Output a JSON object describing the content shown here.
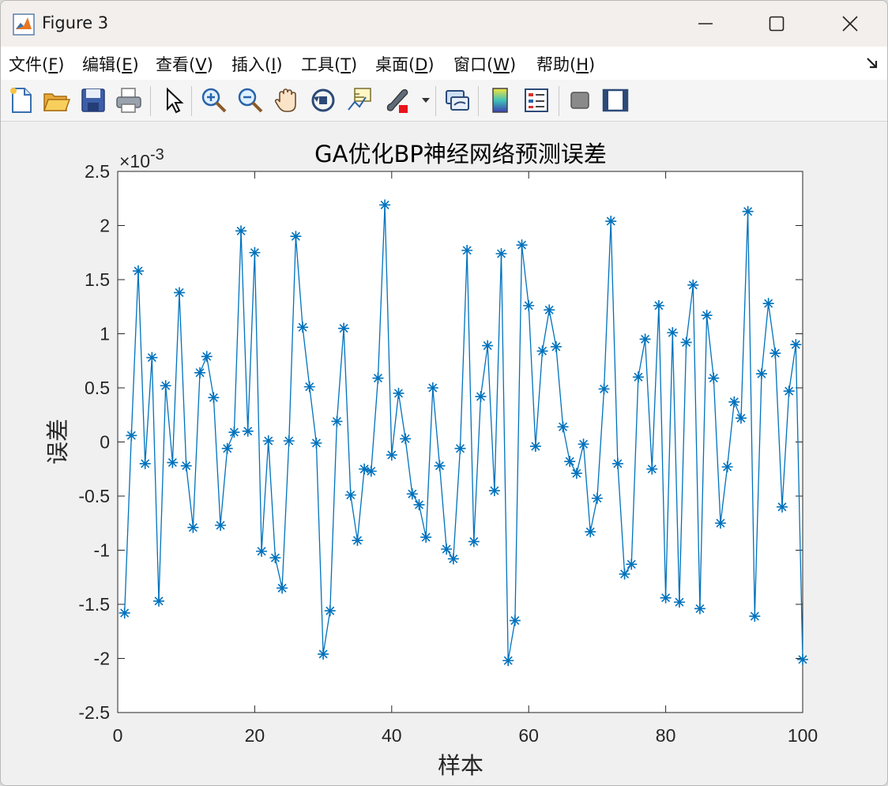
{
  "window": {
    "title": "Figure 3"
  },
  "menu": [
    {
      "text": "文件(",
      "key": "F",
      "end": ")"
    },
    {
      "text": "编辑(",
      "key": "E",
      "end": ")"
    },
    {
      "text": "查看(",
      "key": "V",
      "end": ")"
    },
    {
      "text": "插入(",
      "key": "I",
      "end": ")"
    },
    {
      "text": "工具(",
      "key": "T",
      "end": ")"
    },
    {
      "text": "桌面(",
      "key": "D",
      "end": ")"
    },
    {
      "text": "窗口(",
      "key": "W",
      "end": ")"
    },
    {
      "text": "帮助(",
      "key": "H",
      "end": ")"
    }
  ],
  "toolbar": {
    "icons": [
      "new-figure-icon",
      "open-file-icon",
      "save-icon",
      "print-icon",
      "select-arrow-icon",
      "zoom-in-icon",
      "zoom-out-icon",
      "pan-hand-icon",
      "rotate-3d-icon",
      "data-cursor-icon",
      "brush-icon",
      "link-plot-icon",
      "colorbar-icon",
      "legend-icon",
      "hide-plot-tools-icon",
      "show-plot-tools-icon"
    ]
  },
  "colors": {
    "series": "#0072BD",
    "titlebar": "#f3efec",
    "plot_bg": "#ffffff",
    "figure_bg": "#f0f0f0"
  },
  "chart_data": {
    "type": "line",
    "title": "GA优化BP神经网络预测误差",
    "xlabel": "样本",
    "ylabel": "误差",
    "exponent_label": "×10",
    "exponent_power": "-3",
    "xlim": [
      0,
      100
    ],
    "ylim": [
      -2.5,
      2.5
    ],
    "xticks": [
      "0",
      "20",
      "40",
      "60",
      "80",
      "100"
    ],
    "yticks": [
      "-2.5",
      "-2",
      "-1.5",
      "-1",
      "-0.5",
      "0",
      "0.5",
      "1",
      "1.5",
      "2",
      "2.5"
    ],
    "marker": "asterisk",
    "grid": false,
    "series": [
      {
        "x": [
          1,
          2,
          3,
          4,
          5,
          6,
          7,
          8,
          9,
          10,
          11,
          12,
          13,
          14,
          15,
          16,
          17,
          18,
          19,
          20,
          21,
          22,
          23,
          24,
          25,
          26,
          27,
          28,
          29,
          30,
          31,
          32,
          33,
          34,
          35,
          36,
          37,
          38,
          39,
          40,
          41,
          42,
          43,
          44,
          45,
          46,
          47,
          48,
          49,
          50,
          51,
          52,
          53,
          54,
          55,
          56,
          57,
          58,
          59,
          60,
          61,
          62,
          63,
          64,
          65,
          66,
          67,
          68,
          69,
          70,
          71,
          72,
          73,
          74,
          75,
          76,
          77,
          78,
          79,
          80,
          81,
          82,
          83,
          84,
          85,
          86,
          87,
          88,
          89,
          90,
          91,
          92,
          93,
          94,
          95,
          96,
          97,
          98,
          99,
          100
        ],
        "values": [
          -1.58,
          0.06,
          1.58,
          -0.2,
          0.78,
          -1.47,
          0.52,
          -0.19,
          1.38,
          -0.22,
          -0.79,
          0.64,
          0.79,
          0.41,
          -0.77,
          -0.06,
          0.09,
          1.95,
          0.1,
          1.75,
          -1.01,
          0.01,
          -1.07,
          -1.35,
          0.01,
          1.9,
          1.06,
          0.51,
          -0.01,
          -1.96,
          -1.56,
          0.19,
          1.05,
          -0.49,
          -0.91,
          -0.25,
          -0.27,
          0.59,
          2.19,
          -0.12,
          0.45,
          0.03,
          -0.48,
          -0.58,
          -0.88,
          0.5,
          -0.22,
          -0.99,
          -1.08,
          -0.06,
          1.77,
          -0.92,
          0.42,
          0.89,
          -0.45,
          1.74,
          -2.02,
          -1.65,
          1.82,
          1.26,
          -0.04,
          0.84,
          1.22,
          0.88,
          0.14,
          -0.18,
          -0.29,
          -0.02,
          -0.83,
          -0.52,
          0.49,
          2.04,
          -0.2,
          -1.22,
          -1.13,
          0.6,
          0.95,
          -0.25,
          1.26,
          -1.44,
          1.01,
          -1.48,
          0.92,
          1.45,
          -1.54,
          1.17,
          0.59,
          -0.75,
          -0.23,
          0.37,
          0.22,
          2.13,
          -1.61,
          0.63,
          1.28,
          0.82,
          -0.6,
          0.47,
          0.9,
          -2.01
        ]
      }
    ]
  }
}
